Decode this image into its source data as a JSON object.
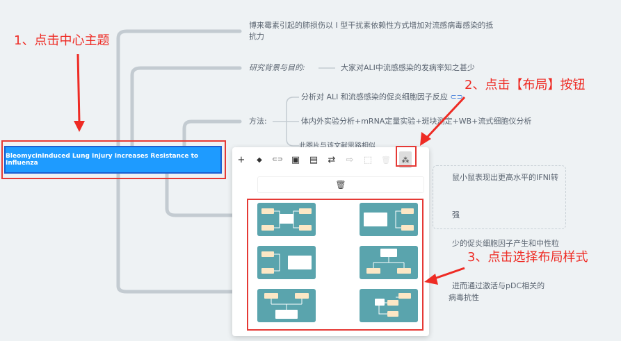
{
  "annotations": {
    "step1": "1、点击中心主题",
    "step2": "2、点击【布局】按钮",
    "step3": "3、点击选择布局样式"
  },
  "central_topic": "BleomycinInduced Lung Injury Increases Resistance to Influenza",
  "topics": {
    "summary_line1": "博来霉素引起的肺损伤以 I 型干扰素依赖性方式增加对流感病毒感染的抵",
    "summary_line2": "抗力",
    "background_label": "研究背景与目的:",
    "background_text": "大家对ALI中流感感染的发病率知之甚少",
    "methods_label": "方法:",
    "method1": "分析对 ALI 和流感感染的促炎细胞因子反应",
    "method2": "体内外实验分析+mRNA定量实验+斑块测定+WB+流式细胞仪分析",
    "method3": "此图片与该文献思路相似",
    "result1": "鼠小鼠表现出更高水平的IFNI转",
    "result2": "强",
    "result3": "少的促炎细胞因子产生和中性粒",
    "conclusion1": "进而通过激活与pDC相关的",
    "conclusion2": "病毒抗性"
  },
  "toolbar": {
    "items": [
      {
        "name": "add-icon",
        "glyph": "+"
      },
      {
        "name": "paint-bucket-icon",
        "glyph": "◆"
      },
      {
        "name": "link-icon",
        "glyph": "⊂⊃"
      },
      {
        "name": "image-icon",
        "glyph": "▣"
      },
      {
        "name": "note-icon",
        "glyph": "▤"
      },
      {
        "name": "relation-icon",
        "glyph": "⇄"
      },
      {
        "name": "summary-icon",
        "glyph": "⇨"
      },
      {
        "name": "boundary-icon",
        "glyph": "⬚"
      },
      {
        "name": "delete-icon",
        "glyph": "🗑"
      },
      {
        "name": "layout-icon",
        "glyph": "⁂"
      }
    ],
    "trash_glyph": "🗑"
  },
  "colors": {
    "accent": "#1e9bff",
    "annotation_red": "#ee2b24",
    "thumb_bg": "#5aa4ad",
    "thumb_node": "#fce7c5"
  }
}
